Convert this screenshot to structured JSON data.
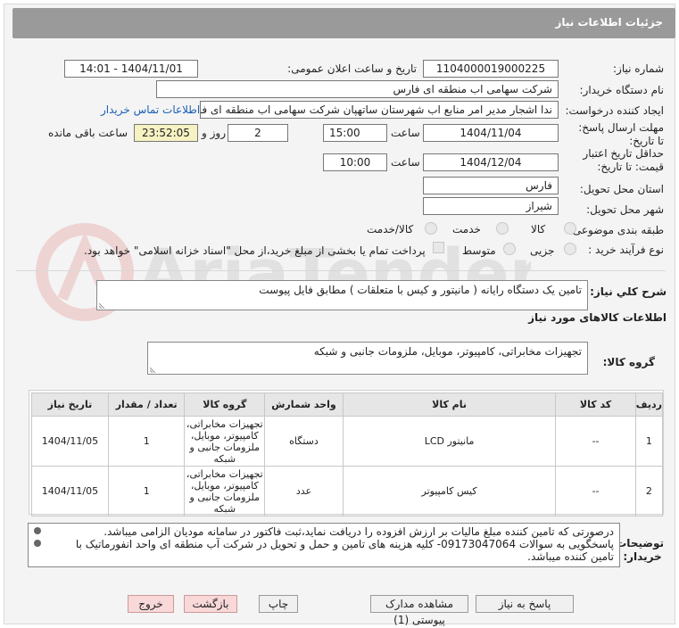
{
  "header": {
    "title": "جزئیات اطلاعات نیاز"
  },
  "fields": {
    "need_number_label": "شماره نیاز:",
    "need_number": "1104000019000225",
    "announce_label": "تاریخ و ساعت اعلان عمومی:",
    "announce_value": "1404/11/01 - 14:01",
    "buyer_org_label": "نام دستگاه خریدار:",
    "buyer_org": "شرکت سهامی اب منطقه ای فارس",
    "creator_label": "ایجاد کننده درخواست:",
    "creator": "ندا اشجار مدیر امر منابع اب شهرستان ساتهپان شرکت سهامی اب منطقه ای فارس",
    "contact_link": "اطلاعات تماس خریدار",
    "reply_deadline_label": "مهلت ارسال پاسخ: تا تاریخ:",
    "reply_date": "1404/11/04",
    "time_label": "ساعت",
    "reply_time": "15:00",
    "days_value": "2",
    "days_and_label": "روز و",
    "remaining_time": "23:52:05",
    "remaining_label": "ساعت باقی مانده",
    "price_validity_label": "حداقل تاریخ اعتبار قیمت: تا تاریخ:",
    "price_date": "1404/12/04",
    "price_time_label": "ساعت",
    "price_time": "10:00",
    "province_label": "استان محل تحویل:",
    "province": "فارس",
    "city_label": "شهر محل تحویل:",
    "city": "شیراز",
    "category_label": "طبقه بندی موضوعی:",
    "category_options": [
      "کالا",
      "خدمت",
      "کالا/خدمت"
    ],
    "process_label": "نوع فرآیند خرید :",
    "process_options": [
      "جزیی",
      "متوسط"
    ],
    "payment_note": "پرداخت تمام یا بخشی از مبلغ خرید،از محل \"اسناد خزانه اسلامی\" خواهد بود."
  },
  "description": {
    "label": "شرح کلي نیاز:",
    "value": "تامین یک دستگاه رایانه ( مانیتور و کیس با متعلقات ) مطابق فایل پیوست"
  },
  "goods_section_title": "اطلاعات کالاهای مورد نیاز",
  "goods_group": {
    "label": "گروه کالا:",
    "value": "تجهیزات مخابراتی، کامپیوتر، موبایل، ملزومات جانبی و شبکه"
  },
  "table": {
    "headers": [
      "ردیف",
      "کد کالا",
      "نام کالا",
      "واحد شمارش",
      "گروه کالا",
      "تعداد / مقدار",
      "تاریخ نیاز"
    ],
    "rows": [
      [
        "1",
        "--",
        "مانیتور LCD",
        "دستگاه",
        "تجهیزات مخابراتی، کامپیوتر، موبایل، ملزومات جانبی و شبکه",
        "1",
        "1404/11/05"
      ],
      [
        "2",
        "--",
        "کیس کامپیوتر",
        "عدد",
        "تجهیزات مخابراتی، کامپیوتر، موبایل، ملزومات جانبی و شبکه",
        "1",
        "1404/11/05"
      ]
    ]
  },
  "notes": {
    "label": "توضیحات خریدار:",
    "line1": "درصورتی که تامین کننده مبلغ مالیات بر ارزش افزوده را دریافت نماید،ثبت فاکتور در سامانه مودیان الزامی میباشد.",
    "line2": "پاسخگویی به سوالات 09173047064- کلیه  هزینه های تامین و حمل و تحویل در شرکت آب منطقه ای واحد انفورماتیک با",
    "line3": "تامین کننده میباشد."
  },
  "buttons": {
    "reply": "پاسخ به نیاز",
    "attachments": "مشاهده مدارک پیوستی (1)",
    "print": "چاپ",
    "back": "بازگشت",
    "exit": "خروج"
  },
  "watermark": {
    "text": "AriaTender.neT"
  },
  "colors": {
    "header": "#9a9a9a",
    "link": "#1a5fb4",
    "highlight": "#f6f2c2",
    "exit_button": "#f8d8d8"
  }
}
